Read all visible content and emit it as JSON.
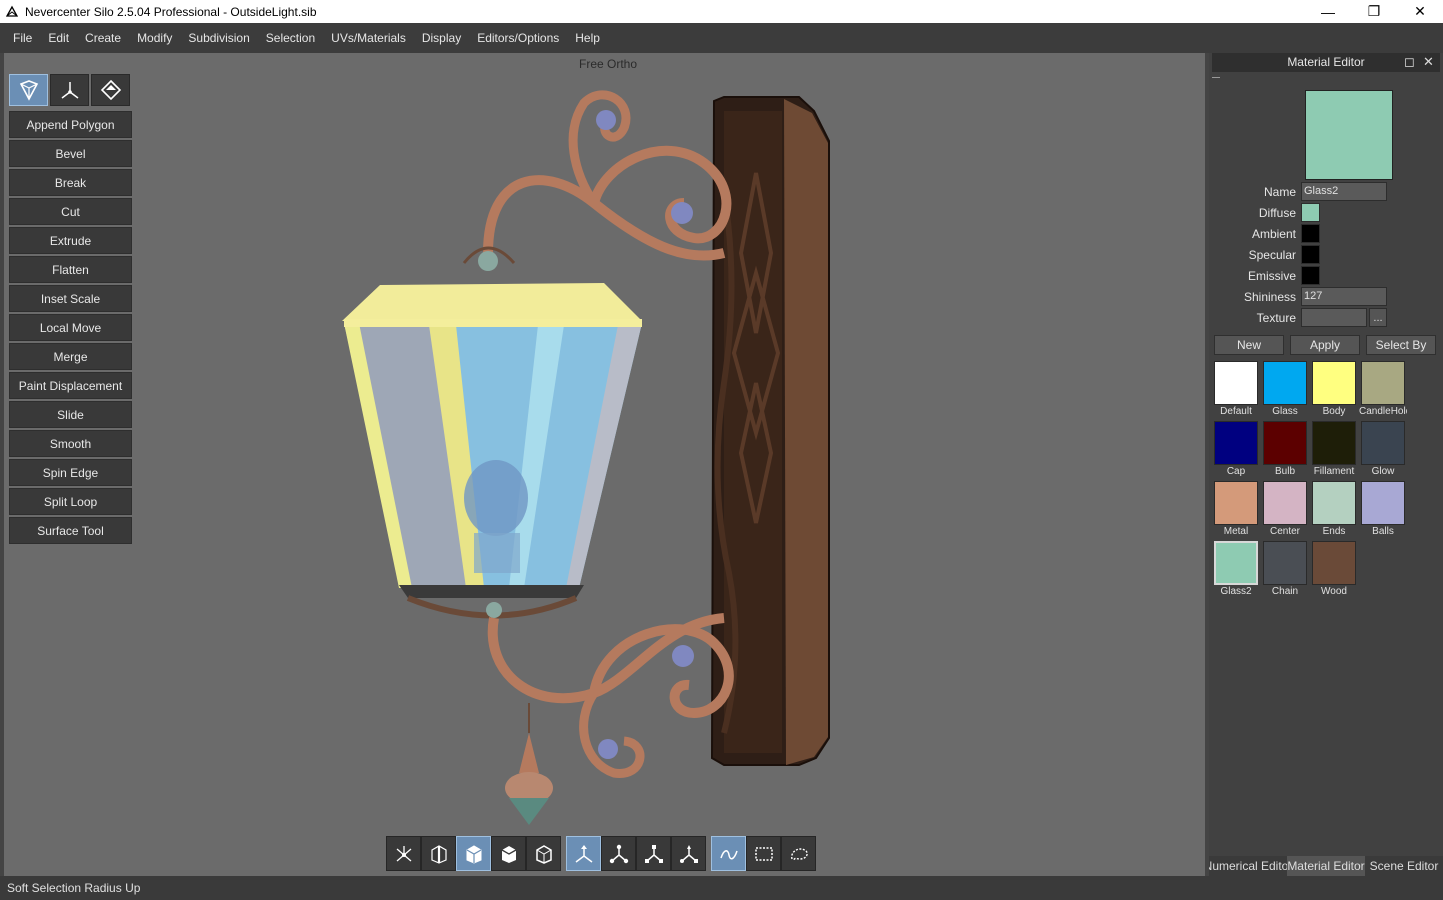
{
  "window": {
    "title": "Nevercenter Silo 2.5.04 Professional - OutsideLight.sib",
    "minimize": "—",
    "maximize": "❐",
    "close": "✕"
  },
  "menu": [
    "File",
    "Edit",
    "Create",
    "Modify",
    "Subdivision",
    "Selection",
    "UVs/Materials",
    "Display",
    "Editors/Options",
    "Help"
  ],
  "viewport": {
    "label": "Free Ortho"
  },
  "tools": [
    "Append Polygon",
    "Bevel",
    "Break",
    "Cut",
    "Extrude",
    "Flatten",
    "Inset Scale",
    "Local Move",
    "Merge",
    "Paint Displacement",
    "Slide",
    "Smooth",
    "Spin Edge",
    "Split Loop",
    "Surface Tool"
  ],
  "material_editor": {
    "title": "Material Editor",
    "preview_color": "#8ecbb2",
    "labels": {
      "name": "Name",
      "diffuse": "Diffuse",
      "ambient": "Ambient",
      "specular": "Specular",
      "emissive": "Emissive",
      "shininess": "Shininess",
      "texture": "Texture"
    },
    "name_value": "Glass2",
    "diffuse_color": "#8ecbb2",
    "ambient_color": "#000000",
    "specular_color": "#000000",
    "emissive_color": "#000000",
    "shininess_value": "127",
    "texture_value": "",
    "texture_browse": "...",
    "buttons": {
      "new": "New",
      "apply": "Apply",
      "select_by": "Select By"
    },
    "materials": [
      {
        "name": "Default",
        "color": "#ffffff"
      },
      {
        "name": "Glass",
        "color": "#00a8f0"
      },
      {
        "name": "Body",
        "color": "#ffff80"
      },
      {
        "name": "CandleHolder",
        "color": "#a8a882"
      },
      {
        "name": "Cap",
        "color": "#000080"
      },
      {
        "name": "Bulb",
        "color": "#5c0000"
      },
      {
        "name": "Fillament",
        "color": "#1e1e08"
      },
      {
        "name": "Glow",
        "color": "#3a4450"
      },
      {
        "name": "Metal",
        "color": "#d49a7a"
      },
      {
        "name": "Center",
        "color": "#d4b4c4"
      },
      {
        "name": "Ends",
        "color": "#b4d0c0"
      },
      {
        "name": "Balls",
        "color": "#a8a8d4"
      },
      {
        "name": "Glass2",
        "color": "#8ecbb2"
      },
      {
        "name": "Chain",
        "color": "#4a4e54"
      },
      {
        "name": "Wood",
        "color": "#6a4a38"
      }
    ],
    "selected_material": "Glass2"
  },
  "panel_tabs": [
    "Numerical Editor",
    "Material Editor",
    "Scene Editor"
  ],
  "active_tab": "Material Editor",
  "status": "Soft Selection Radius Up"
}
